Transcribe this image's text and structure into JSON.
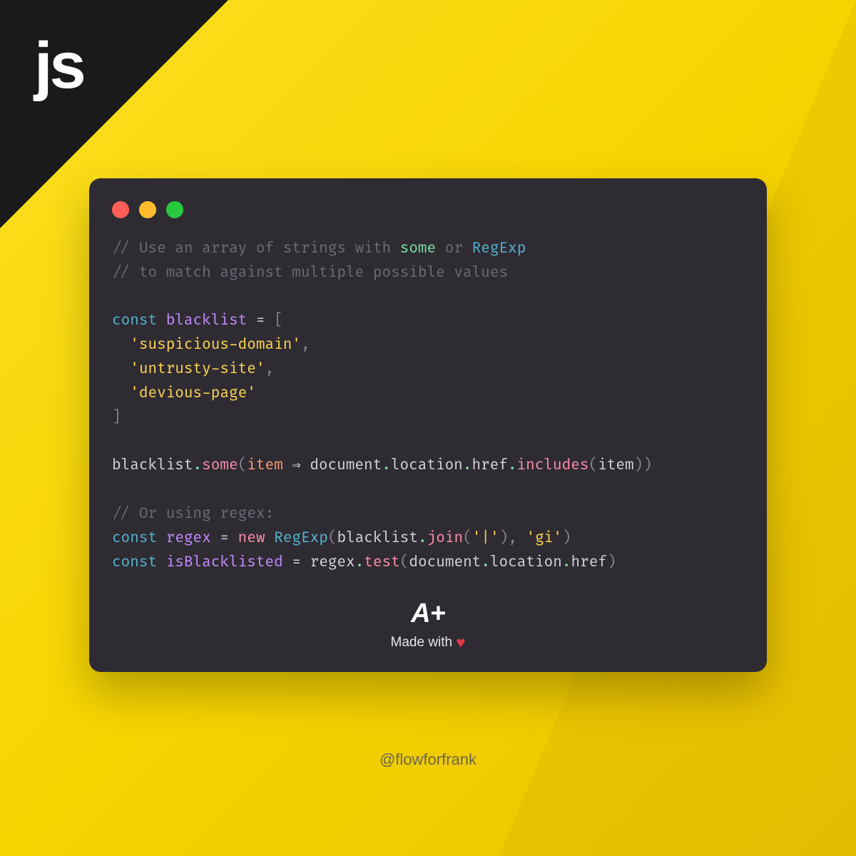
{
  "logo": "js",
  "code": {
    "comment1_pre": "// Use an array of strings with ",
    "comment1_some": "some",
    "comment1_mid": " or ",
    "comment1_regexp": "RegExp",
    "comment2": "// to match against multiple possible values",
    "kw_const": "const",
    "var_blacklist": "blacklist",
    "eq": " = ",
    "lbracket": "[",
    "str1": "'suspicious-domain'",
    "str2": "'untrusty-site'",
    "str3": "'devious-page'",
    "comma": ",",
    "rbracket": "]",
    "ident_blacklist": "blacklist",
    "dot": ".",
    "m_some": "some",
    "lparen": "(",
    "rparen": ")",
    "param_item": "item",
    "arrow": " ⇒ ",
    "ident_document": "document",
    "ident_location": "location",
    "ident_href": "href",
    "m_includes": "includes",
    "comment3": "// Or using regex:",
    "var_regex": "regex",
    "kw_new": "new",
    "class_RegExp": "RegExp",
    "m_join": "join",
    "str_pipe": "'|'",
    "str_gi": "'gi'",
    "var_isBlacklisted": "isBlacklisted",
    "m_test": "test"
  },
  "badge": {
    "aplus": "A+",
    "madewith_pre": "Made with ",
    "heart": "♥"
  },
  "handle": "@flowforfrank"
}
